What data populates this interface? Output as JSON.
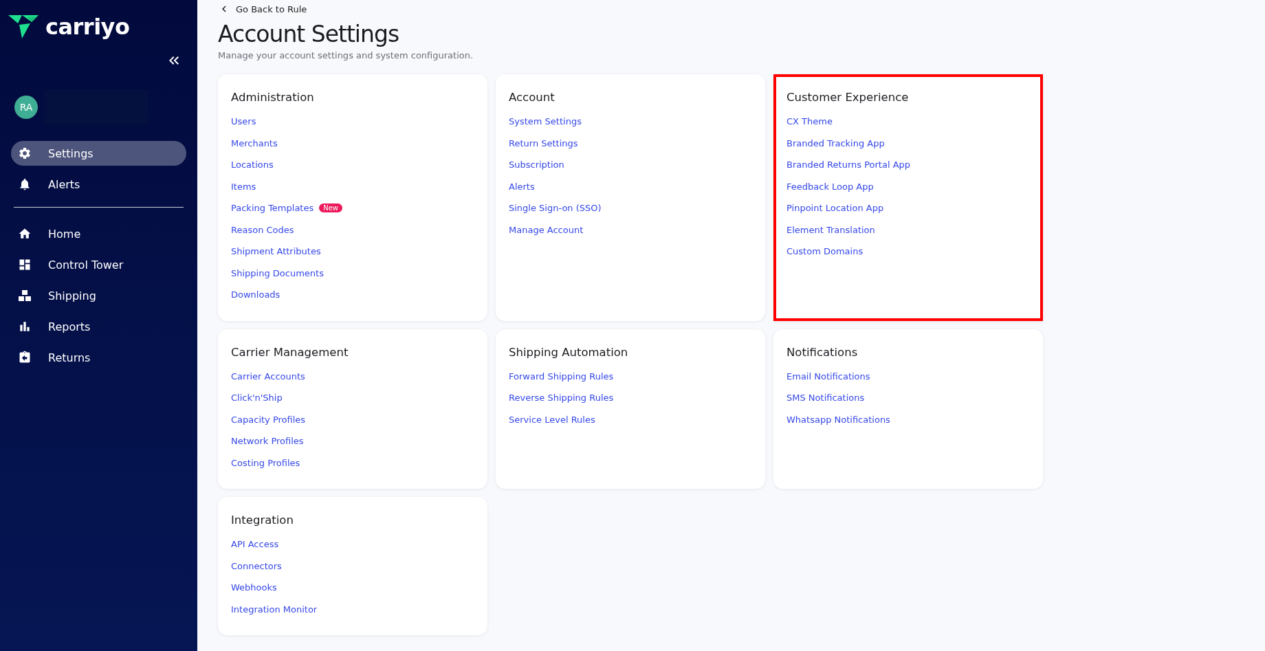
{
  "sidebar": {
    "logo": "carriyo",
    "user": {
      "initials": "RA"
    },
    "top_items": [
      {
        "label": "Settings",
        "selected": true
      },
      {
        "label": "Alerts",
        "selected": false
      }
    ],
    "items": [
      {
        "label": "Home",
        "selected": false
      },
      {
        "label": "Control Tower",
        "selected": false
      },
      {
        "label": "Shipping",
        "selected": false
      },
      {
        "label": "Reports",
        "selected": false
      },
      {
        "label": "Returns",
        "selected": false
      }
    ]
  },
  "header": {
    "back_link": "Go Back to Rule",
    "title": "Account Settings",
    "subtitle": "Manage your account settings and system configuration."
  },
  "sections": [
    {
      "title": "Administration",
      "highlighted": false,
      "links": [
        {
          "label": "Users"
        },
        {
          "label": "Merchants"
        },
        {
          "label": "Locations"
        },
        {
          "label": "Items"
        },
        {
          "label": "Packing Templates",
          "badge": "New"
        },
        {
          "label": "Reason Codes"
        },
        {
          "label": "Shipment Attributes"
        },
        {
          "label": "Shipping Documents"
        },
        {
          "label": "Downloads"
        }
      ]
    },
    {
      "title": "Account",
      "highlighted": false,
      "links": [
        {
          "label": "System Settings"
        },
        {
          "label": "Return Settings"
        },
        {
          "label": "Subscription"
        },
        {
          "label": "Alerts"
        },
        {
          "label": "Single Sign-on (SSO)"
        },
        {
          "label": "Manage Account"
        }
      ]
    },
    {
      "title": "Customer Experience",
      "highlighted": true,
      "links": [
        {
          "label": "CX Theme"
        },
        {
          "label": "Branded Tracking App"
        },
        {
          "label": "Branded Returns Portal App"
        },
        {
          "label": "Feedback Loop App"
        },
        {
          "label": "Pinpoint Location App"
        },
        {
          "label": "Element Translation"
        },
        {
          "label": "Custom Domains"
        }
      ]
    },
    {
      "title": "Carrier Management",
      "highlighted": false,
      "links": [
        {
          "label": "Carrier Accounts"
        },
        {
          "label": "Click'n'Ship"
        },
        {
          "label": "Capacity Profiles"
        },
        {
          "label": "Network Profiles"
        },
        {
          "label": "Costing Profiles"
        }
      ]
    },
    {
      "title": "Shipping Automation",
      "highlighted": false,
      "links": [
        {
          "label": "Forward Shipping Rules"
        },
        {
          "label": "Reverse Shipping Rules"
        },
        {
          "label": "Service Level Rules"
        }
      ]
    },
    {
      "title": "Notifications",
      "highlighted": false,
      "links": [
        {
          "label": "Email Notifications"
        },
        {
          "label": "SMS Notifications"
        },
        {
          "label": "Whatsapp Notifications"
        }
      ]
    },
    {
      "title": "Integration",
      "highlighted": false,
      "links": [
        {
          "label": "API Access"
        },
        {
          "label": "Connectors"
        },
        {
          "label": "Webhooks"
        },
        {
          "label": "Integration Monitor"
        }
      ]
    }
  ]
}
